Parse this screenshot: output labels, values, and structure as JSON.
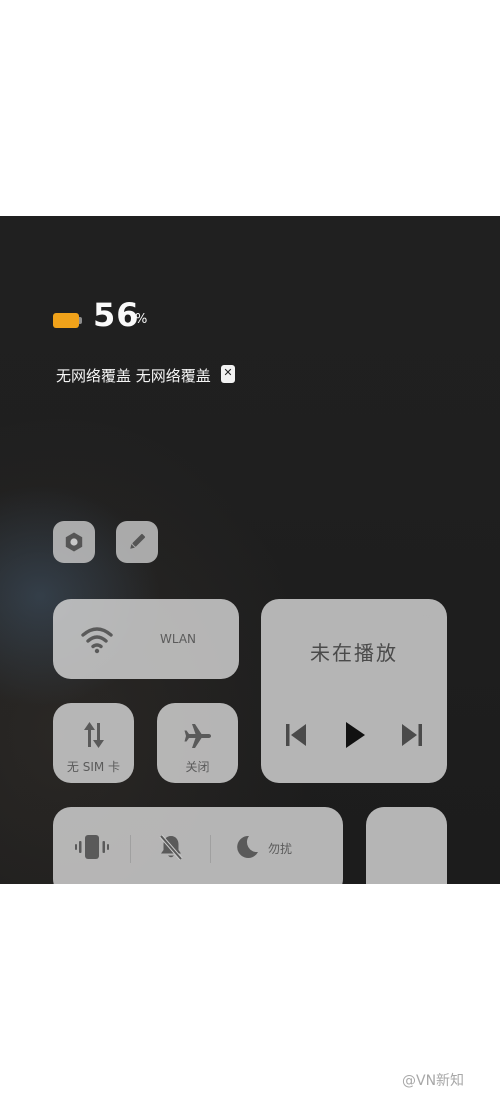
{
  "status": {
    "battery_percent": 56,
    "battery_number": "56",
    "battery_unit": "%",
    "battery_color": "#f0a21a",
    "carrier_text": "无网络覆盖 无网络覆盖",
    "sim_icon": "x-sim-icon"
  },
  "shortcuts": {
    "settings_icon": "gear-icon",
    "edit_icon": "pencil-icon"
  },
  "tiles": {
    "wlan": {
      "label": "WLAN",
      "icon": "wifi-icon"
    },
    "mobile_data": {
      "label": "无 SIM 卡",
      "icon": "data-arrows-icon"
    },
    "airplane": {
      "label": "关闭",
      "icon": "airplane-icon"
    },
    "media": {
      "title": "未在播放",
      "prev_icon": "previous-track-icon",
      "play_icon": "play-icon",
      "next_icon": "next-track-icon"
    },
    "sound_modes": {
      "vibrate_icon": "vibrate-icon",
      "mute_icon": "bell-off-icon",
      "dnd_icon": "moon-icon",
      "dnd_label": "勿扰"
    }
  },
  "watermark": "@VN新知"
}
